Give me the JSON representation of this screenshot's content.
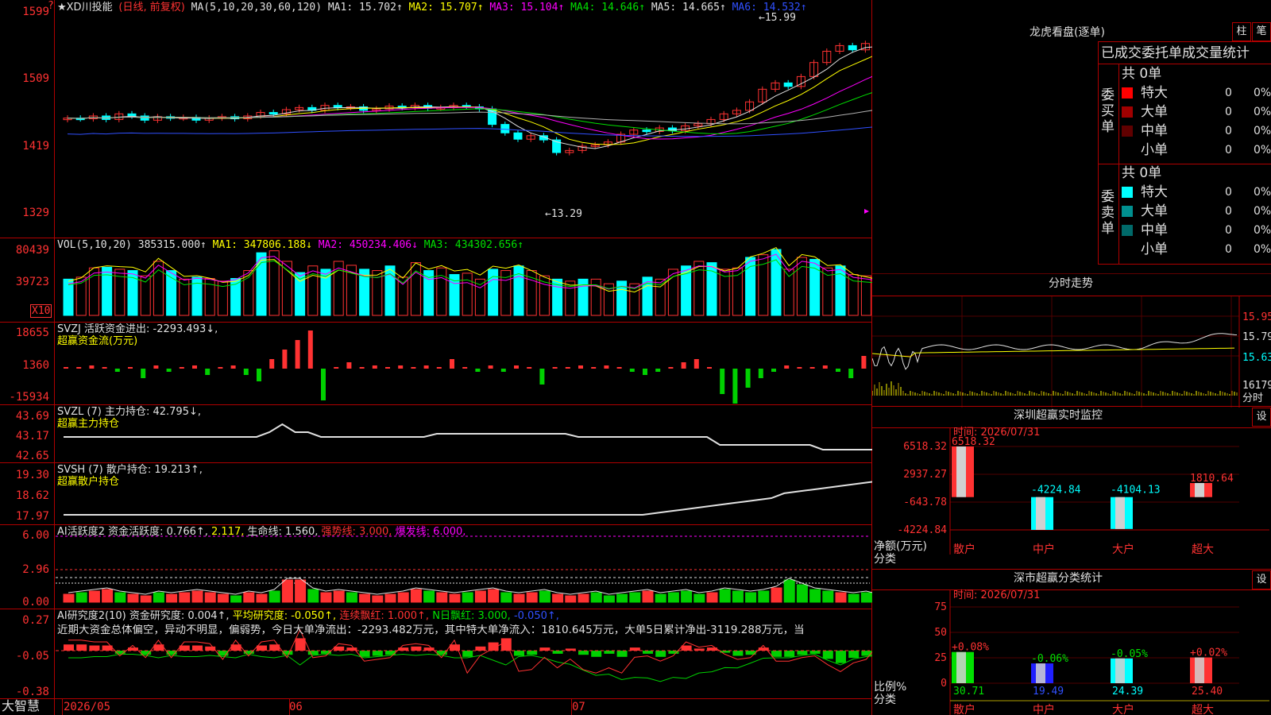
{
  "app_name": "大智慧",
  "main_chart": {
    "title": "★XD川投能",
    "period": "(日线, 前复权)",
    "ma_params": "MA(5,10,20,30,60,120)",
    "ma1": "MA1: 15.702↑",
    "ma2": "MA2: 15.707↑",
    "ma3": "MA3: 15.104↑",
    "ma4": "MA4: 14.646↑",
    "ma5": "MA5: 14.665↑",
    "ma6": "MA6: 14.532↑",
    "high_label": "←15.99",
    "low_label": "←13.29",
    "y_ticks": [
      "1599",
      "1509",
      "1419",
      "1329"
    ],
    "corner_mark": "?"
  },
  "vol_panel": {
    "header": "VOL(5,10,20)",
    "value": "385315.000↑",
    "ma1": "MA1: 347806.188↓",
    "ma2": "MA2: 450234.406↓",
    "ma3": "MA3: 434302.656↑",
    "y_ticks": [
      "80439",
      "39723"
    ],
    "unit": "X10"
  },
  "svzj_panel": {
    "header": "SVZJ  活跃资金进出: -2293.493↓,",
    "sub": "超赢资金流(万元)",
    "y_ticks": [
      "18655",
      "1360",
      "-15934"
    ]
  },
  "svzl_panel": {
    "header": "SVZL (7) 主力持仓: 42.795↓,",
    "sub": "超赢主力持仓",
    "y_ticks": [
      "43.69",
      "43.17",
      "42.65"
    ]
  },
  "svsh_panel": {
    "header": "SVSH (7) 散户持仓: 19.213↑,",
    "sub": "超赢散户持仓",
    "y_ticks": [
      "19.30",
      "18.62",
      "17.97"
    ]
  },
  "ai_active_panel": {
    "h1": "AI活跃度2 资金活跃度: 0.766↑,",
    "h2": "2.117,",
    "h3": "生命线: 1.560,",
    "h4": "强势线: 3.000,",
    "h5": "爆发线: 6.000,",
    "y_ticks": [
      "6.00",
      "2.96",
      "0.00"
    ]
  },
  "ai_research_panel": {
    "h1": "AI研究度2(10) 资金研究度: 0.004↑,",
    "h2": "平均研究度: -0.050↑,",
    "h3": "连续飘红: 1.000↑,",
    "h4": "N日飘红: 3.000,",
    "h5": "-0.050↑,",
    "commentary": "近期大资金总体偏空，异动不明显，偏弱势，今日大单净流出：-2293.482万元，其中特大单净流入：1810.645万元，大单5日累计净出-3119.288万元，当",
    "y_ticks": [
      "0.27",
      "-0.05",
      "-0.38"
    ]
  },
  "x_axis": {
    "labels": [
      "2026/05",
      "06",
      "07"
    ]
  },
  "longhu": {
    "title": "龙虎看盘(逐单)",
    "btn1": "柱",
    "btn2": "笔",
    "subtitle": "已成交委托单成交量统计",
    "buy_label": "委买单",
    "sell_label": "委卖单",
    "buy_total": "共 0单",
    "sell_total": "共 0单",
    "buy_rows": [
      {
        "name": "特大",
        "count": "0",
        "pct": "0%",
        "color": "#ff0000"
      },
      {
        "name": "大单",
        "count": "0",
        "pct": "0%",
        "color": "#a00000"
      },
      {
        "name": "中单",
        "count": "0",
        "pct": "0%",
        "color": "#600000"
      },
      {
        "name": "小单",
        "count": "0",
        "pct": "0%",
        "color": "#000000"
      }
    ],
    "sell_rows": [
      {
        "name": "特大",
        "count": "0",
        "pct": "0%",
        "color": "#00ffff"
      },
      {
        "name": "大单",
        "count": "0",
        "pct": "0%",
        "color": "#009090"
      },
      {
        "name": "中单",
        "count": "0",
        "pct": "0%",
        "color": "#006a6a"
      },
      {
        "name": "小单",
        "count": "0",
        "pct": "0%",
        "color": "#000000"
      }
    ]
  },
  "intraday": {
    "title": "分时走势",
    "prices": [
      "15.95",
      "15.79",
      "15.63"
    ],
    "volume": "16179",
    "vol_unit": "分时"
  },
  "monitor": {
    "title": "深圳超赢实时监控",
    "btn": "设",
    "time": "时间: 2026/07/31",
    "y_ticks": [
      "6518.32",
      "2937.27",
      "-643.78",
      "-4224.84"
    ],
    "unit1": "净额(万元)",
    "unit2": "分类",
    "bars": [
      {
        "cat": "散户",
        "value": 6518.32,
        "label": "6518.32",
        "color": "#ff3232"
      },
      {
        "cat": "中户",
        "value": -4224.84,
        "label": "-4224.84",
        "color": "#00ffff"
      },
      {
        "cat": "大户",
        "value": -4104.13,
        "label": "-4104.13",
        "color": "#00ffff"
      },
      {
        "cat": "超大",
        "value": 1810.64,
        "label": "1810.64",
        "color": "#ff3232"
      }
    ]
  },
  "classify": {
    "title": "深市超赢分类统计",
    "btn": "设",
    "time": "时间: 2026/07/31",
    "y_ticks": [
      "75",
      "50",
      "25",
      "0"
    ],
    "unit1": "比例%",
    "unit2": "分类",
    "bars": [
      {
        "cat": "散户",
        "value": 30.71,
        "label": "30.71",
        "change": "+0.08%",
        "color": "#00e000"
      },
      {
        "cat": "中户",
        "value": 19.49,
        "label": "19.49",
        "change": "-0.06%",
        "color": "#2020ff"
      },
      {
        "cat": "大户",
        "value": 24.39,
        "label": "24.39",
        "change": "-0.05%",
        "color": "#00ffff"
      },
      {
        "cat": "超大",
        "value": 25.4,
        "label": "25.40",
        "change": "+0.02%",
        "color": "#ff3232"
      }
    ]
  },
  "colors": {
    "up": "#ff3232",
    "down": "#00ffff",
    "grid": "#b00000",
    "accent_yellow": "#ffff00"
  }
}
